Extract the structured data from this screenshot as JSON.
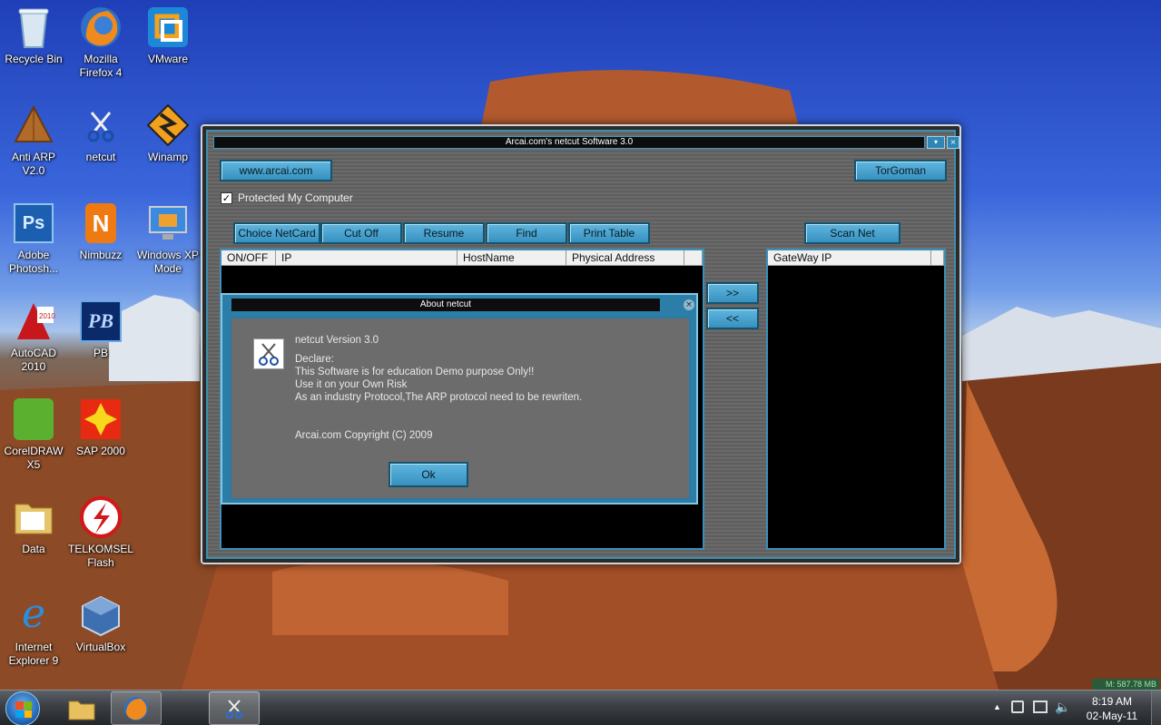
{
  "desktop_icons": [
    {
      "label": "Recycle Bin",
      "icon": "recycle-bin-icon"
    },
    {
      "label": "Mozilla Firefox 4",
      "icon": "firefox-icon"
    },
    {
      "label": "VMware",
      "icon": "vmware-icon"
    },
    {
      "label": "Anti ARP V2.0",
      "icon": "anti-arp-icon"
    },
    {
      "label": "netcut",
      "icon": "netcut-icon"
    },
    {
      "label": "Winamp",
      "icon": "winamp-icon"
    },
    {
      "label": "Adobe Photosh...",
      "icon": "photoshop-icon"
    },
    {
      "label": "Nimbuzz",
      "icon": "nimbuzz-icon"
    },
    {
      "label": "Windows XP Mode",
      "icon": "windows-xp-mode-icon"
    },
    {
      "label": "AutoCAD 2010",
      "icon": "autocad-icon"
    },
    {
      "label": "PB",
      "icon": "pb-icon"
    },
    {
      "label": "CorelDRAW X5",
      "icon": "coreldraw-icon"
    },
    {
      "label": "SAP 2000",
      "icon": "sap2000-icon"
    },
    {
      "label": "Data",
      "icon": "folder-icon"
    },
    {
      "label": "TELKOMSEL Flash",
      "icon": "telkomsel-flash-icon"
    },
    {
      "label": "Internet Explorer 9",
      "icon": "internet-explorer-icon"
    },
    {
      "label": "VirtualBox",
      "icon": "virtualbox-icon"
    }
  ],
  "netcut": {
    "title": "Arcai.com's netcut Software 3.0",
    "website_button": "www.arcai.com",
    "torgoman_button": "TorGoman",
    "protected_label": "Protected My Computer",
    "protected_checked": true,
    "toolbar": [
      "Choice NetCard",
      "Cut Off",
      "Resume",
      "Find",
      "Print Table"
    ],
    "scan_button": "Scan Net",
    "columns": [
      "ON/OFF",
      "IP",
      "HostName",
      "Physical Address"
    ],
    "move_right": ">>",
    "move_left": "<<",
    "gateway_column": "GateWay IP"
  },
  "about": {
    "title": "About netcut",
    "version": "netcut Version 3.0",
    "declare": "Declare:",
    "line1": "This Software is for education Demo purpose Only!!",
    "line2": "Use it on your Own Risk",
    "line3": "As an industry Protocol,The ARP protocol need to be rewriten.",
    "copyright": "Arcai.com Copyright (C) 2009",
    "ok": "Ok"
  },
  "memory_meter": "M: 587.78 MB",
  "taskbar": {
    "time": "8:19 AM",
    "date": "02-May-11",
    "tray_arrow": "▲"
  }
}
